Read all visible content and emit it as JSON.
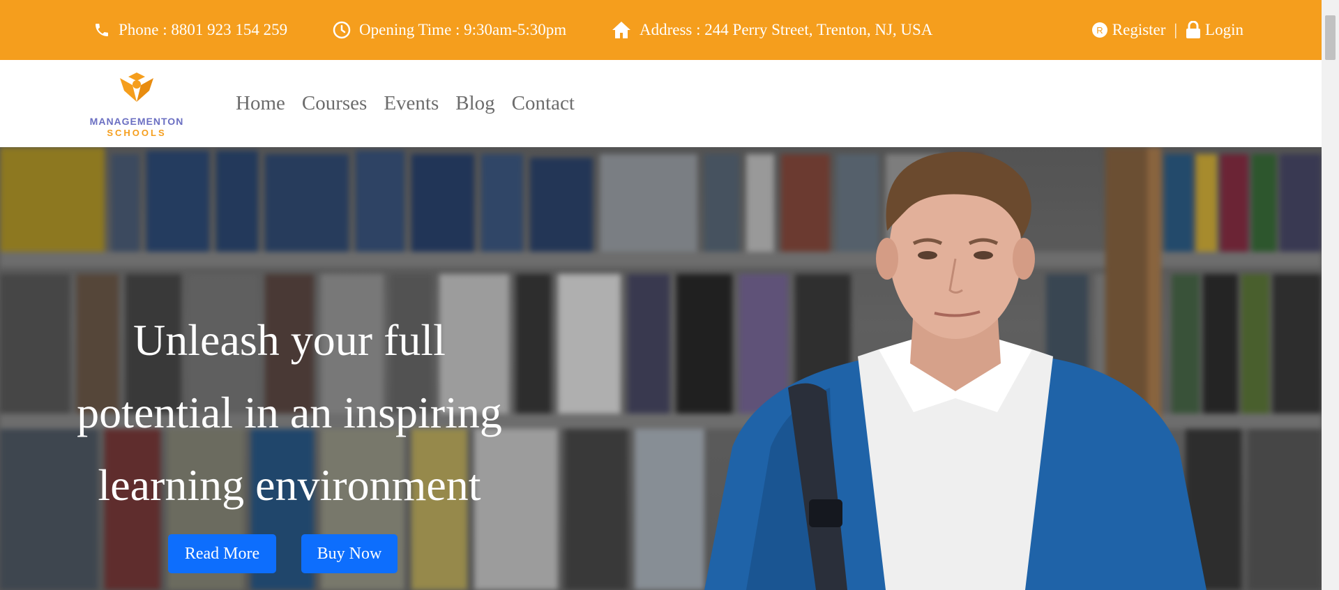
{
  "topbar": {
    "phone_label": "Phone :",
    "phone_value": "8801 923 154 259",
    "hours_label": "Opening Time :",
    "hours_value": "9:30am-5:30pm",
    "address_label": "Address :",
    "address_value": "244 Perry Street, Trenton, NJ, USA",
    "register": "Register",
    "separator": "|",
    "login": "Login"
  },
  "logo": {
    "line1": "MANAGEMENTON",
    "line2": "SCHOOLS"
  },
  "nav": {
    "items": [
      "Home",
      "Courses",
      "Events",
      "Blog",
      "Contact"
    ]
  },
  "hero": {
    "title_line1": "Unleash your full",
    "title_line2": "potential in an inspiring",
    "title_line3": "learning environment",
    "read_more": "Read More",
    "buy_now": "Buy Now"
  },
  "colors": {
    "accent": "#f59e1d",
    "button": "#0d6efd",
    "nav_text": "#6c6c6c",
    "logo_purple": "#6b6fc2"
  },
  "icons": [
    "phone-icon",
    "clock-icon",
    "home-icon",
    "register-icon",
    "lock-icon",
    "logo-mark-icon"
  ]
}
